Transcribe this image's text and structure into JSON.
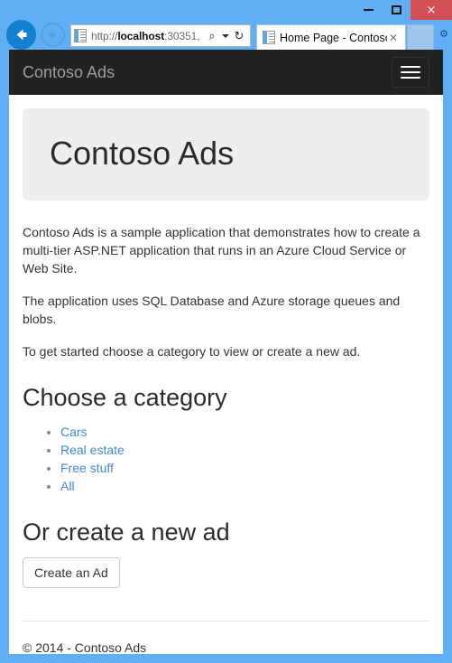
{
  "browser": {
    "window_controls": {
      "minimize_label": "Minimize",
      "maximize_label": "Maximize",
      "close_label": "×"
    },
    "back_label": "Back",
    "forward_label": "Forward",
    "address": {
      "scheme": "http://",
      "host": "localhost",
      "rest": ":30351,",
      "full": "http://localhost:30351,",
      "search_icon": "⌕",
      "refresh_icon": "↻"
    },
    "tab": {
      "title": "Home Page - Contoso...",
      "close_label": "✕"
    },
    "tools_icon": "⚙"
  },
  "navbar": {
    "brand": "Contoso Ads",
    "toggle_label": "Toggle navigation"
  },
  "jumbotron": {
    "title": "Contoso Ads"
  },
  "main": {
    "paragraphs": [
      "Contoso Ads is a sample application that demonstrates how to create a multi-tier ASP.NET application that runs in an Azure Cloud Service or Web Site.",
      "The application uses SQL Database and Azure storage queues and blobs.",
      "To get started choose a category to view or create a new ad."
    ],
    "category_heading": "Choose a category",
    "categories": [
      {
        "label": "Cars"
      },
      {
        "label": "Real estate"
      },
      {
        "label": "Free stuff"
      },
      {
        "label": "All"
      }
    ],
    "create_heading": "Or create a new ad",
    "create_button_label": "Create an Ad"
  },
  "footer": {
    "text": "© 2014 - Contoso Ads"
  },
  "colors": {
    "window_frame": "#62AEF5",
    "navbar_bg": "#222222",
    "brand_text": "#9d9d9d",
    "jumbotron_bg": "#eeeeee",
    "link": "#428bca",
    "close_button": "#D05055"
  }
}
